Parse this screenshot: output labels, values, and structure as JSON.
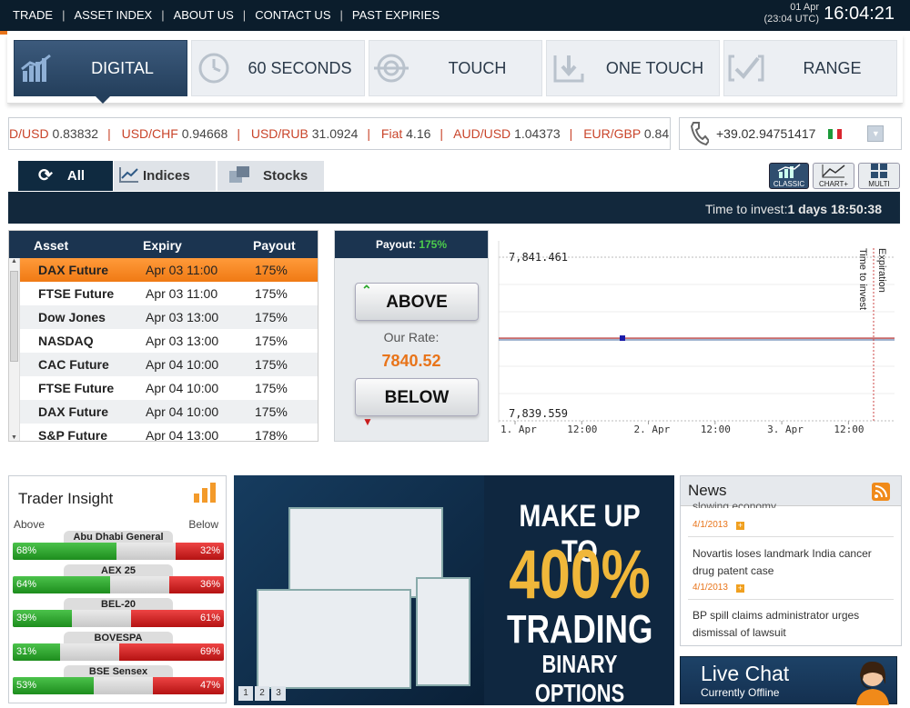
{
  "topbar": {
    "nav": [
      "TRADE",
      "ASSET INDEX",
      "ABOUT US",
      "CONTACT US",
      "PAST EXPIRIES"
    ],
    "date": "01 Apr",
    "utc": "(23:04 UTC)",
    "clock": "16:04:21"
  },
  "trade_tabs": [
    {
      "label": "DIGITAL",
      "icon": "bar-chart-icon",
      "active": true
    },
    {
      "label": "60 SECONDS",
      "icon": "clock-icon",
      "active": false
    },
    {
      "label": "TOUCH",
      "icon": "target-icon",
      "active": false
    },
    {
      "label": "ONE TOUCH",
      "icon": "down-arrow-icon",
      "active": false
    },
    {
      "label": "RANGE",
      "icon": "range-icon",
      "active": false
    }
  ],
  "ticker": [
    {
      "pair": "D/USD",
      "value": "0.83832"
    },
    {
      "pair": "USD/CHF",
      "value": "0.94668"
    },
    {
      "pair": "USD/RUB",
      "value": "31.0924"
    },
    {
      "pair": "Fiat",
      "value": "4.16"
    },
    {
      "pair": "AUD/USD",
      "value": "1.04373"
    },
    {
      "pair": "EUR/GBP",
      "value": "0.84"
    }
  ],
  "phone": {
    "number": "+39.02.94751417"
  },
  "asset_tabs": {
    "all": "All",
    "indices": "Indices",
    "stocks": "Stocks"
  },
  "view_buttons": {
    "classic": "CLASSIC",
    "chartplus": "CHART+",
    "multi": "MULTI"
  },
  "time_to_invest": {
    "label": "Time to invest:",
    "value": "1 days 18:50:38"
  },
  "asset_table": {
    "headers": {
      "asset": "Asset",
      "expiry": "Expiry",
      "payout": "Payout"
    },
    "rows": [
      {
        "asset": "DAX Future",
        "expiry": "Apr 03 11:00",
        "payout": "175%"
      },
      {
        "asset": "FTSE Future",
        "expiry": "Apr 03 11:00",
        "payout": "175%"
      },
      {
        "asset": "Dow Jones",
        "expiry": "Apr 03 13:00",
        "payout": "175%"
      },
      {
        "asset": "NASDAQ",
        "expiry": "Apr 03 13:00",
        "payout": "175%"
      },
      {
        "asset": "CAC Future",
        "expiry": "Apr 04 10:00",
        "payout": "175%"
      },
      {
        "asset": "FTSE Future",
        "expiry": "Apr 04 10:00",
        "payout": "175%"
      },
      {
        "asset": "DAX Future",
        "expiry": "Apr 04 10:00",
        "payout": "175%"
      },
      {
        "asset": "S&P Future",
        "expiry": "Apr 04 13:00",
        "payout": "178%"
      }
    ]
  },
  "trade_box": {
    "payout_label": "Payout:",
    "payout_value": "175%",
    "above": "ABOVE",
    "below": "BELOW",
    "rate_label": "Our Rate:",
    "rate_value": "7840.52"
  },
  "chart": {
    "y_top": "7,841.461",
    "y_bottom": "7,839.559",
    "x_labels": [
      "1. Apr",
      "12:00",
      "2. Apr",
      "12:00",
      "3. Apr",
      "12:00"
    ],
    "marker1": "Time to invest",
    "marker2": "Expiration"
  },
  "chart_data": {
    "type": "line",
    "title": "",
    "xlabel": "",
    "ylabel": "",
    "x": [
      "1. Apr",
      "12:00",
      "2. Apr",
      "12:00",
      "3. Apr",
      "12:00"
    ],
    "ylim": [
      7839.559,
      7841.461
    ],
    "series": [
      {
        "values": [
          7840.52,
          7840.52
        ]
      }
    ],
    "annotations": [
      "Time to invest",
      "Expiration"
    ]
  },
  "insight": {
    "title": "Trader Insight",
    "above": "Above",
    "below": "Below",
    "items": [
      {
        "name": "Abu Dhabi General",
        "above": "68%",
        "below": "32%",
        "above_frac": 0.68
      },
      {
        "name": "AEX 25",
        "above": "64%",
        "below": "36%",
        "above_frac": 0.64
      },
      {
        "name": "BEL-20",
        "above": "39%",
        "below": "61%",
        "above_frac": 0.39
      },
      {
        "name": "BOVESPA",
        "above": "31%",
        "below": "69%",
        "above_frac": 0.31
      },
      {
        "name": "BSE Sensex",
        "above": "53%",
        "below": "47%",
        "above_frac": 0.53
      }
    ]
  },
  "banner": {
    "line1": "MAKE UP TO",
    "line2": "400%",
    "line3": "TRADING",
    "line4": "BINARY OPTIONS",
    "pages": [
      "1",
      "2",
      "3"
    ]
  },
  "news": {
    "title": "News",
    "partial": "slowing economy",
    "items": [
      {
        "date": "4/1/2013",
        "headline": ""
      },
      {
        "date": "4/1/2013",
        "headline": "Novartis loses landmark India cancer drug patent case"
      },
      {
        "date": "",
        "headline": "BP spill claims administrator urges dismissal of lawsuit"
      }
    ]
  },
  "livechat": {
    "title": "Live Chat",
    "status": "Currently Offline"
  },
  "colors": {
    "accent": "#e8741a",
    "navy": "#1b3450",
    "green": "#2aa82a",
    "red": "#c81d1d"
  }
}
